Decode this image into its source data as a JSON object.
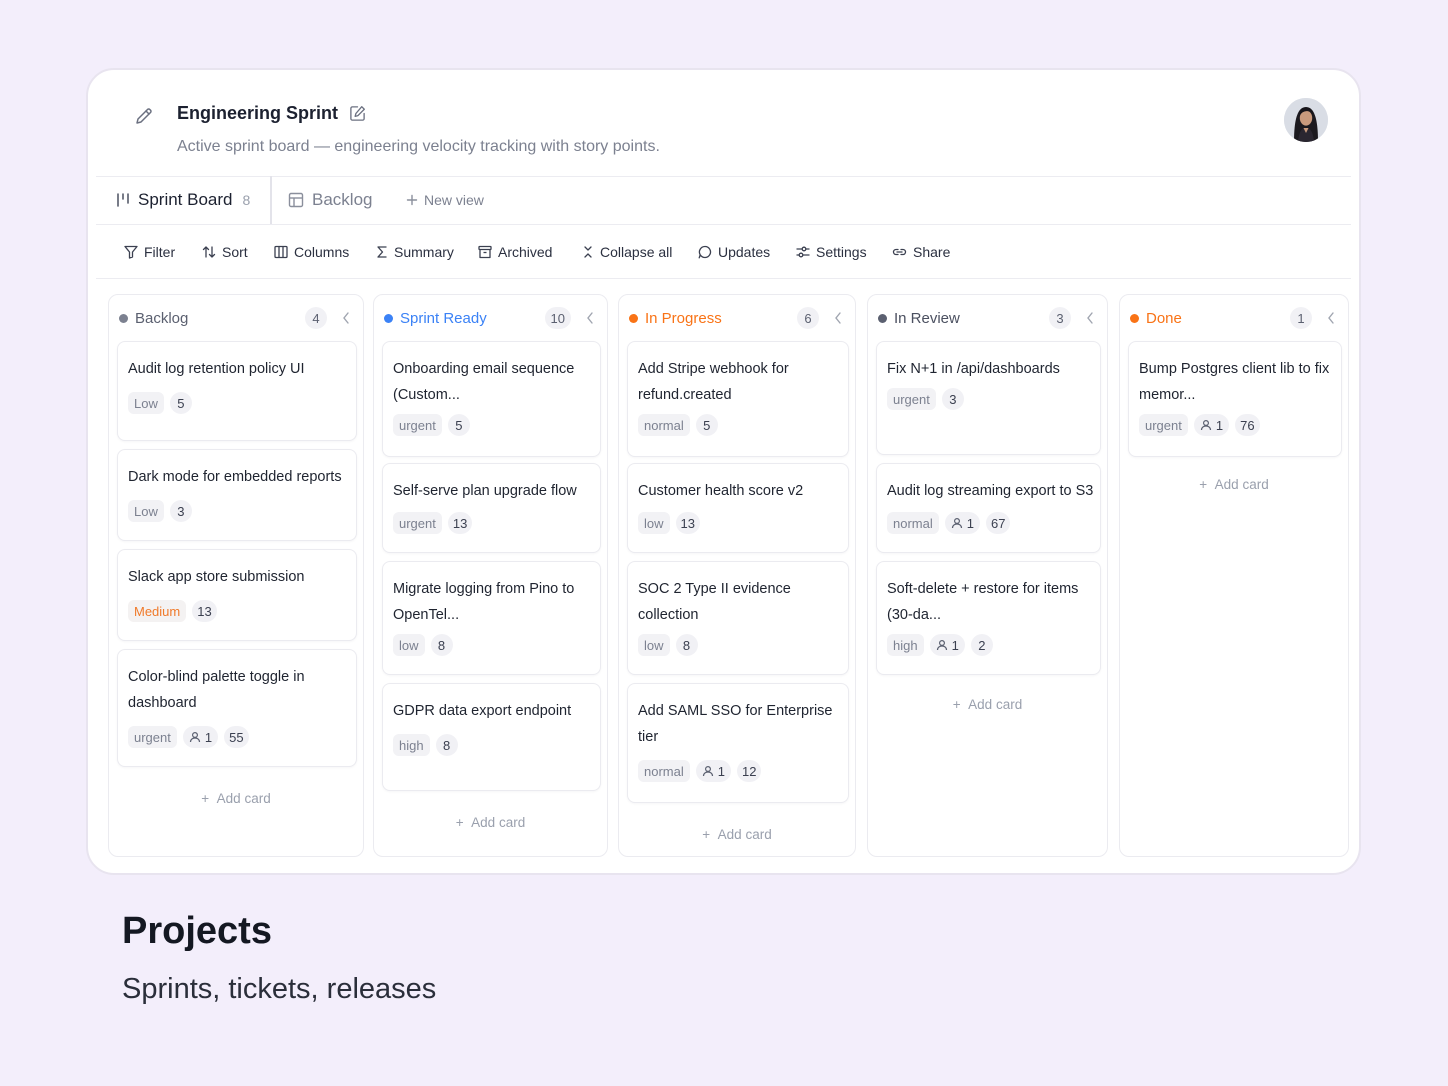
{
  "header": {
    "title": "Engineering Sprint",
    "subtitle": "Active sprint board — engineering velocity tracking with story points."
  },
  "tabs": [
    {
      "label": "Sprint Board",
      "count": "8",
      "icon": "board-icon",
      "active": true
    },
    {
      "label": "Backlog",
      "icon": "table-icon"
    },
    {
      "label": "New view",
      "icon": "plus-icon"
    }
  ],
  "toolbar": {
    "filter": "Filter",
    "sort": "Sort",
    "columns": "Columns",
    "summary": "Summary",
    "archived": "Archived",
    "collapse_all": "Collapse all",
    "updates": "Updates",
    "settings": "Settings",
    "share": "Share"
  },
  "board": {
    "add_card": "Add card",
    "columns": [
      {
        "title": "Backlog",
        "count": "4",
        "color": "#7c8190",
        "cards": [
          {
            "title": "Audit log retention policy UI",
            "priority": "Low",
            "points": "5"
          },
          {
            "title": "Dark mode for embedded reports",
            "priority": "Low",
            "points": "3"
          },
          {
            "title": "Slack app store submission",
            "priority": "Medium",
            "points": "13"
          },
          {
            "title": "Color-blind palette toggle in dashboard",
            "priority": "urgent",
            "assignees": "1",
            "points": "55"
          }
        ]
      },
      {
        "title": "Sprint Ready",
        "count": "10",
        "color": "#3b82f6",
        "cards": [
          {
            "title": "Onboarding email sequence (Custom...",
            "priority": "urgent",
            "points": "5"
          },
          {
            "title": "Self-serve plan upgrade flow",
            "priority": "urgent",
            "points": "13"
          },
          {
            "title": "Migrate logging from Pino to OpenTel...",
            "priority": "low",
            "points": "8"
          },
          {
            "title": "GDPR data export endpoint",
            "priority": "high",
            "points": "8"
          }
        ]
      },
      {
        "title": "In Progress",
        "count": "6",
        "color": "#f97316",
        "cards": [
          {
            "title": "Add Stripe webhook for refund.created",
            "priority": "normal",
            "points": "5"
          },
          {
            "title": "Customer health score v2",
            "priority": "low",
            "points": "13"
          },
          {
            "title": "SOC 2 Type II evidence collection",
            "priority": "low",
            "points": "8"
          },
          {
            "title": "Add SAML SSO for Enterprise tier",
            "priority": "normal",
            "assignees": "1",
            "points": "12"
          }
        ]
      },
      {
        "title": "In Review",
        "count": "3",
        "color": "#5b6070",
        "cards": [
          {
            "title": "Fix N+1 in /api/dashboards",
            "priority": "urgent",
            "points": "3"
          },
          {
            "title": "Audit log streaming export to S3",
            "priority": "normal",
            "assignees": "1",
            "points": "67"
          },
          {
            "title": "Soft-delete + restore for items (30-da...",
            "priority": "high",
            "assignees": "1",
            "points": "2"
          }
        ]
      },
      {
        "title": "Done",
        "count": "1",
        "color": "#f97316",
        "cards": [
          {
            "title": "Bump Postgres client lib to fix memor...",
            "priority": "urgent",
            "assignees": "1",
            "points": "76"
          }
        ]
      }
    ]
  },
  "footer": {
    "title": "Projects",
    "subtitle": "Sprints, tickets, releases"
  }
}
